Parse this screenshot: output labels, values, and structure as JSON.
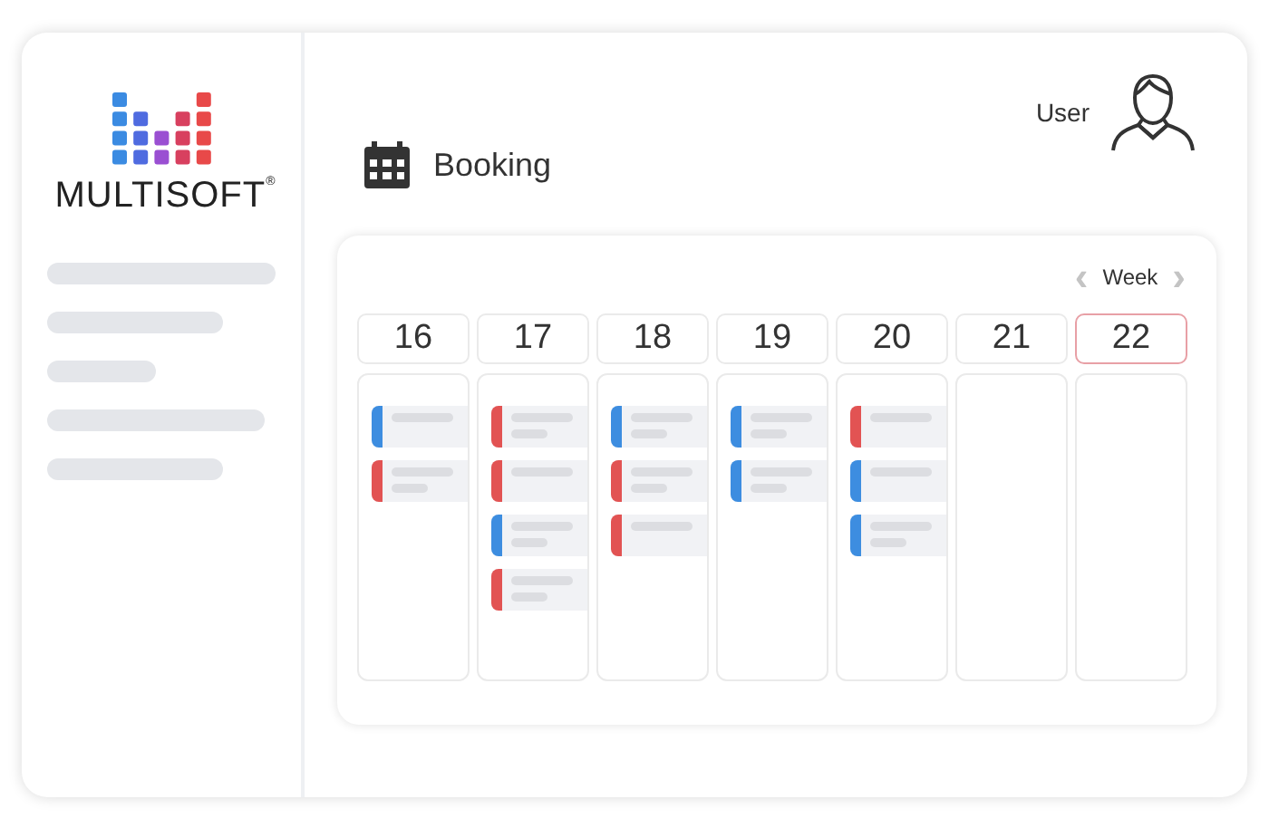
{
  "logo": {
    "name": "MULTISOFT",
    "mark": "®"
  },
  "user": {
    "label": "User"
  },
  "page": {
    "title": "Booking"
  },
  "calendar": {
    "view": "Week",
    "prev": "‹",
    "next": "›",
    "days": [
      {
        "day": "16",
        "selected": false,
        "events": [
          {
            "color": "#3d8de0",
            "kind": "short"
          },
          {
            "color": "#e25353",
            "kind": "long"
          }
        ]
      },
      {
        "day": "17",
        "selected": false,
        "events": [
          {
            "color": "#e25353",
            "kind": "long"
          },
          {
            "color": "#e25353",
            "kind": "short"
          },
          {
            "color": "#3d8de0",
            "kind": "long"
          },
          {
            "color": "#e25353",
            "kind": "long"
          }
        ]
      },
      {
        "day": "18",
        "selected": false,
        "events": [
          {
            "color": "#3d8de0",
            "kind": "long"
          },
          {
            "color": "#e25353",
            "kind": "long"
          },
          {
            "color": "#e25353",
            "kind": "short"
          }
        ]
      },
      {
        "day": "19",
        "selected": false,
        "events": [
          {
            "color": "#3d8de0",
            "kind": "long"
          },
          {
            "color": "#3d8de0",
            "kind": "long"
          }
        ]
      },
      {
        "day": "20",
        "selected": false,
        "events": [
          {
            "color": "#e25353",
            "kind": "short"
          },
          {
            "color": "#3d8de0",
            "kind": "short"
          },
          {
            "color": "#3d8de0",
            "kind": "long"
          }
        ]
      },
      {
        "day": "21",
        "selected": false
      },
      {
        "day": "22",
        "selected": true
      }
    ]
  }
}
